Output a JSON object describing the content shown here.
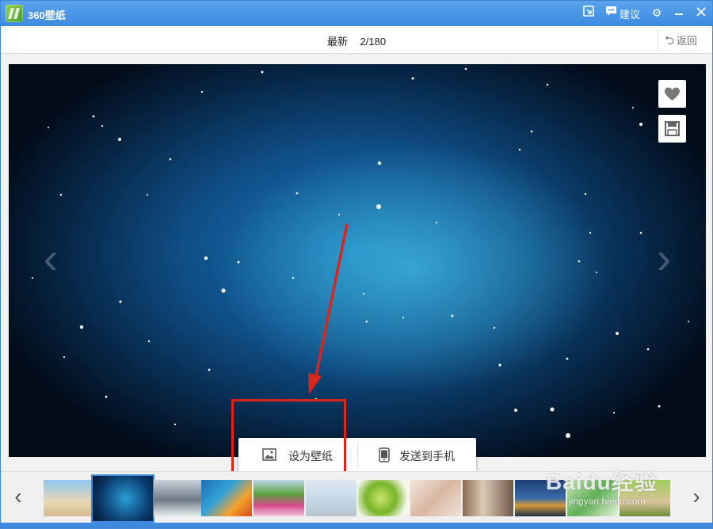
{
  "app": {
    "title": "360壁纸"
  },
  "titlebar": {
    "suggest_label": "建议"
  },
  "toolbar": {
    "category": "最新",
    "page_counter": "2/180",
    "back_label": "返回"
  },
  "actions": {
    "set_wallpaper": "设为壁纸",
    "send_to_phone": "发送到手机"
  },
  "watermark": {
    "brand": "Baidu经验",
    "url": "jingyan.baidu.com"
  },
  "thumbnails": [
    {
      "name": "thumb-statue"
    },
    {
      "name": "thumb-starry-sky"
    },
    {
      "name": "thumb-snowy-mountain"
    },
    {
      "name": "thumb-coral-reef"
    },
    {
      "name": "thumb-flowers"
    },
    {
      "name": "thumb-girl-beach"
    },
    {
      "name": "thumb-lime"
    },
    {
      "name": "thumb-sleeping"
    },
    {
      "name": "thumb-window-girl"
    },
    {
      "name": "thumb-city-night"
    },
    {
      "name": "thumb-green-girl"
    },
    {
      "name": "thumb-puppy"
    }
  ],
  "colors": {
    "accent": "#3d8ae0",
    "highlight_red": "#d9261c"
  }
}
